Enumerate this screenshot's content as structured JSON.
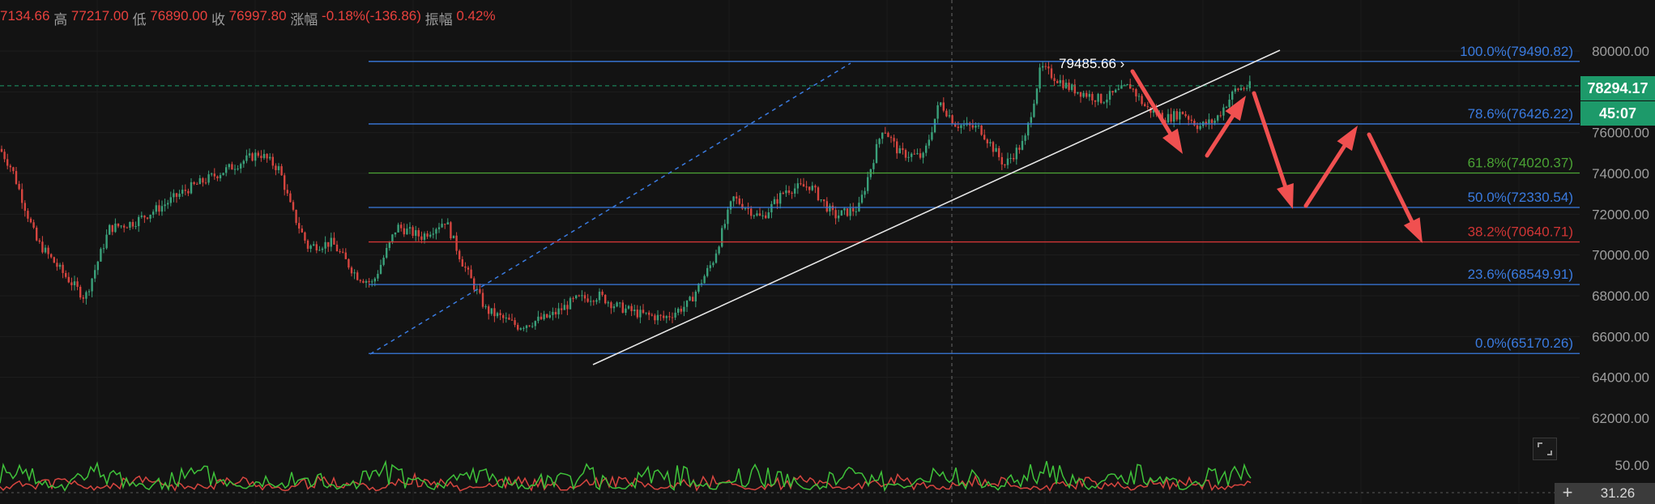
{
  "info_bar": {
    "open_partial": "7134.66",
    "high_label": "高",
    "high_value": "77217.00",
    "low_label": "低",
    "low_value": "76890.00",
    "close_label": "收",
    "close_value": "76997.80",
    "change_label": "涨幅",
    "change_value": "-0.18%(-136.86)",
    "amplitude_label": "振幅",
    "amplitude_value": "0.42%"
  },
  "price_axis": {
    "ticks": [
      "80000.00",
      "78000.00",
      "76000.00",
      "74000.00",
      "72000.00",
      "70000.00",
      "68000.00",
      "66000.00",
      "64000.00",
      "62000.00"
    ],
    "current_price": "78294.17",
    "countdown": "45:07",
    "indicator_top_tick": "50.00",
    "indicator_value": "31.26",
    "plus_label": "+"
  },
  "peak_label": "79485.66",
  "fib_levels": [
    {
      "label": "100.0%(79490.82)",
      "price": 79490.82,
      "color": "#3a7be0"
    },
    {
      "label": "78.6%(76426.22)",
      "price": 76426.22,
      "color": "#3a7be0"
    },
    {
      "label": "61.8%(74020.37)",
      "price": 74020.37,
      "color": "#4aa334"
    },
    {
      "label": "50.0%(72330.54)",
      "price": 72330.54,
      "color": "#3a7be0"
    },
    {
      "label": "38.2%(70640.71)",
      "price": 70640.71,
      "color": "#d03535"
    },
    {
      "label": "23.6%(68549.91)",
      "price": 68549.91,
      "color": "#3a7be0"
    },
    {
      "label": "0.0%(65170.26)",
      "price": 65170.26,
      "color": "#3a7be0"
    }
  ],
  "colors": {
    "background": "#131313",
    "up": "#3aa07a",
    "down": "#d6453f",
    "arrow": "#f05050",
    "trendline": "#e6e6e6",
    "current_price_bg": "#1d9a6a"
  }
}
